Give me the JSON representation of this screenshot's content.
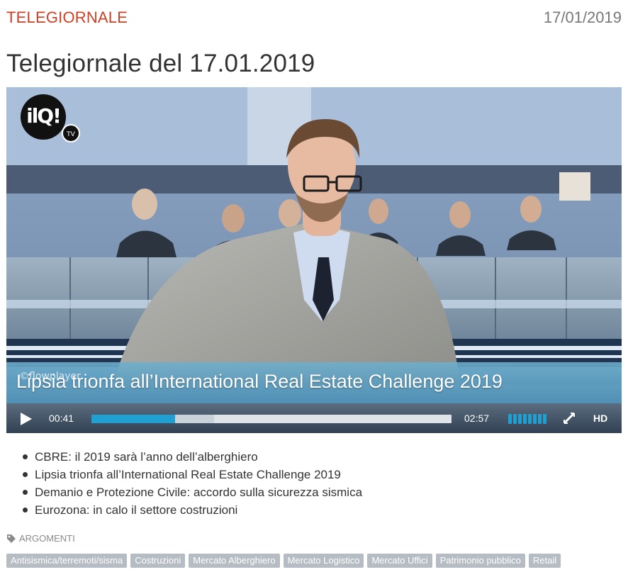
{
  "header": {
    "section": "TELEGIORNALE",
    "date": "17/01/2019"
  },
  "article": {
    "title": "Telegiornale del 17.01.2019"
  },
  "player": {
    "brand": "ilQ!",
    "brand_badge": "TV",
    "watermark": "©flowplayer",
    "ticker": "Lipsia trionfa all’International Real Estate Challenge 2019",
    "elapsed": "00:41",
    "duration": "02:57",
    "progress_fraction": 0.232,
    "buffered_fraction": 0.34,
    "volume_level": 1.0,
    "hd_label": "HD",
    "accent_color": "#1ea0d2"
  },
  "headlines": [
    "CBRE: il 2019 sarà l’anno dell’alberghiero",
    "Lipsia trionfa all’International Real Estate Challenge 2019",
    "Demanio e Protezione Civile: accordo sulla sicurezza sismica",
    "Eurozona: in calo il settore costruzioni"
  ],
  "topics": {
    "label": "ARGOMENTI",
    "icon": "tag-icon",
    "tags": [
      "Antisismica/terremoti/sisma",
      "Costruzioni",
      "Mercato Alberghiero",
      "Mercato Logistico",
      "Mercato Uffici",
      "Patrimonio pubblico",
      "Retail"
    ]
  },
  "colors": {
    "section": "#cc4125",
    "tag_bg": "#b6bcc4"
  }
}
